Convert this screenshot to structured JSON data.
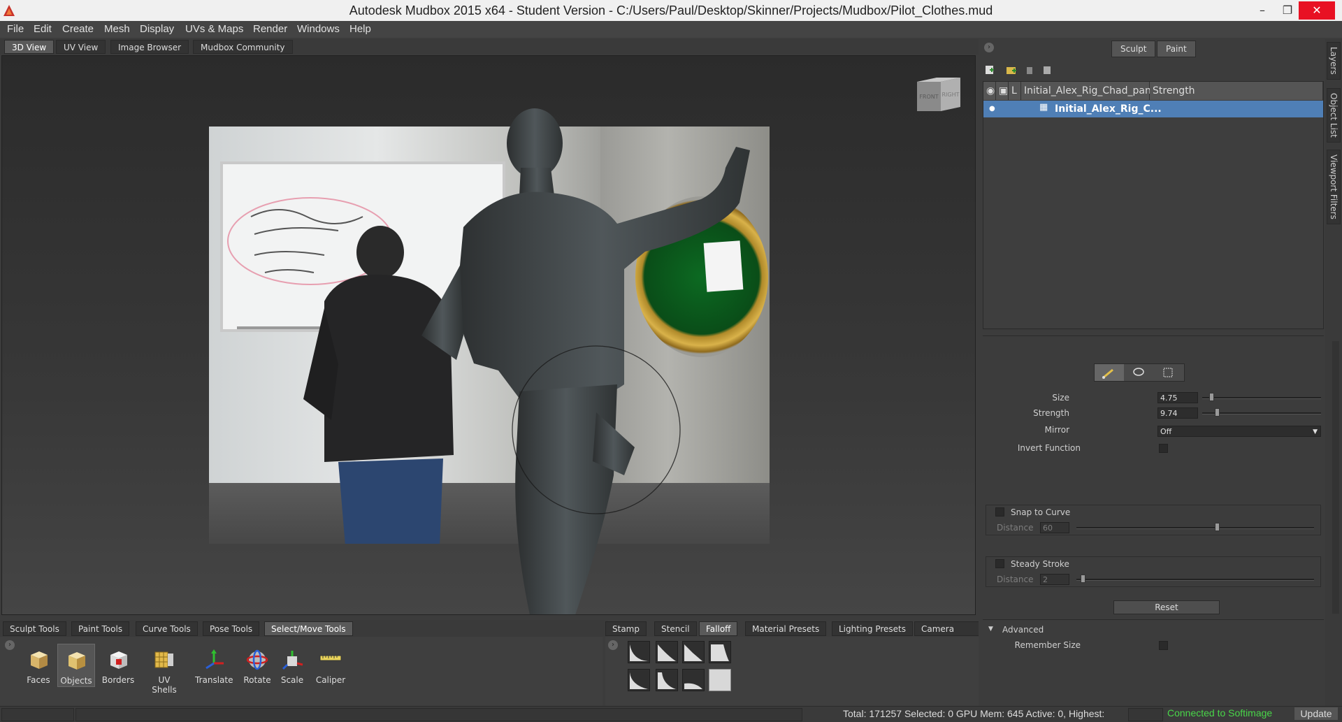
{
  "window": {
    "title": "Autodesk Mudbox 2015 x64 - Student Version - C:/Users/Paul/Desktop/Skinner/Projects/Mudbox/Pilot_Clothes.mud"
  },
  "menu": [
    "File",
    "Edit",
    "Create",
    "Mesh",
    "Display",
    "UVs & Maps",
    "Render",
    "Windows",
    "Help"
  ],
  "view_tabs": [
    "3D View",
    "UV View",
    "Image Browser",
    "Mudbox Community"
  ],
  "navcube": {
    "front": "FRONT",
    "right": "RIGHT"
  },
  "tool_tabs": [
    "Sculpt Tools",
    "Paint Tools",
    "Curve Tools",
    "Pose Tools",
    "Select/Move Tools"
  ],
  "tools": [
    "Faces",
    "Objects",
    "Borders",
    "UV Shells",
    "Translate",
    "Rotate",
    "Scale",
    "Caliper"
  ],
  "tray_tabs": [
    "Stamp",
    "Stencil",
    "Falloff",
    "Material Presets",
    "Lighting Presets",
    "Camera Bookmarks"
  ],
  "status": {
    "text": "Total: 171257  Selected: 0 GPU Mem: 645  Active: 0, Highest:",
    "connected": "Connected to Softimage",
    "update": "Update"
  },
  "right_panel": {
    "sculpt": "Sculpt",
    "paint": "Paint",
    "layers_header": {
      "lock": "L",
      "name": "Initial_Alex_Rig_Chad_pan",
      "strength": "Strength"
    },
    "layer_row": "Initial_Alex_Rig_C...",
    "props": {
      "size_label": "Size",
      "size": "4.75",
      "strength_label": "Strength",
      "strength": "9.74",
      "mirror_label": "Mirror",
      "mirror": "Off",
      "invert_label": "Invert Function",
      "snap_label": "Snap to Curve",
      "distance_label": "Distance",
      "snap_distance": "60",
      "steady_label": "Steady Stroke",
      "steady_distance": "2",
      "reset": "Reset",
      "advanced": "Advanced",
      "remember_label": "Remember Size"
    }
  },
  "side_tabs": [
    "Layers",
    "Object List",
    "Viewport Filters"
  ],
  "colors": {
    "accent_selection": "#4f7fb6",
    "connected_text": "#49d649",
    "close_button": "#e81123"
  }
}
